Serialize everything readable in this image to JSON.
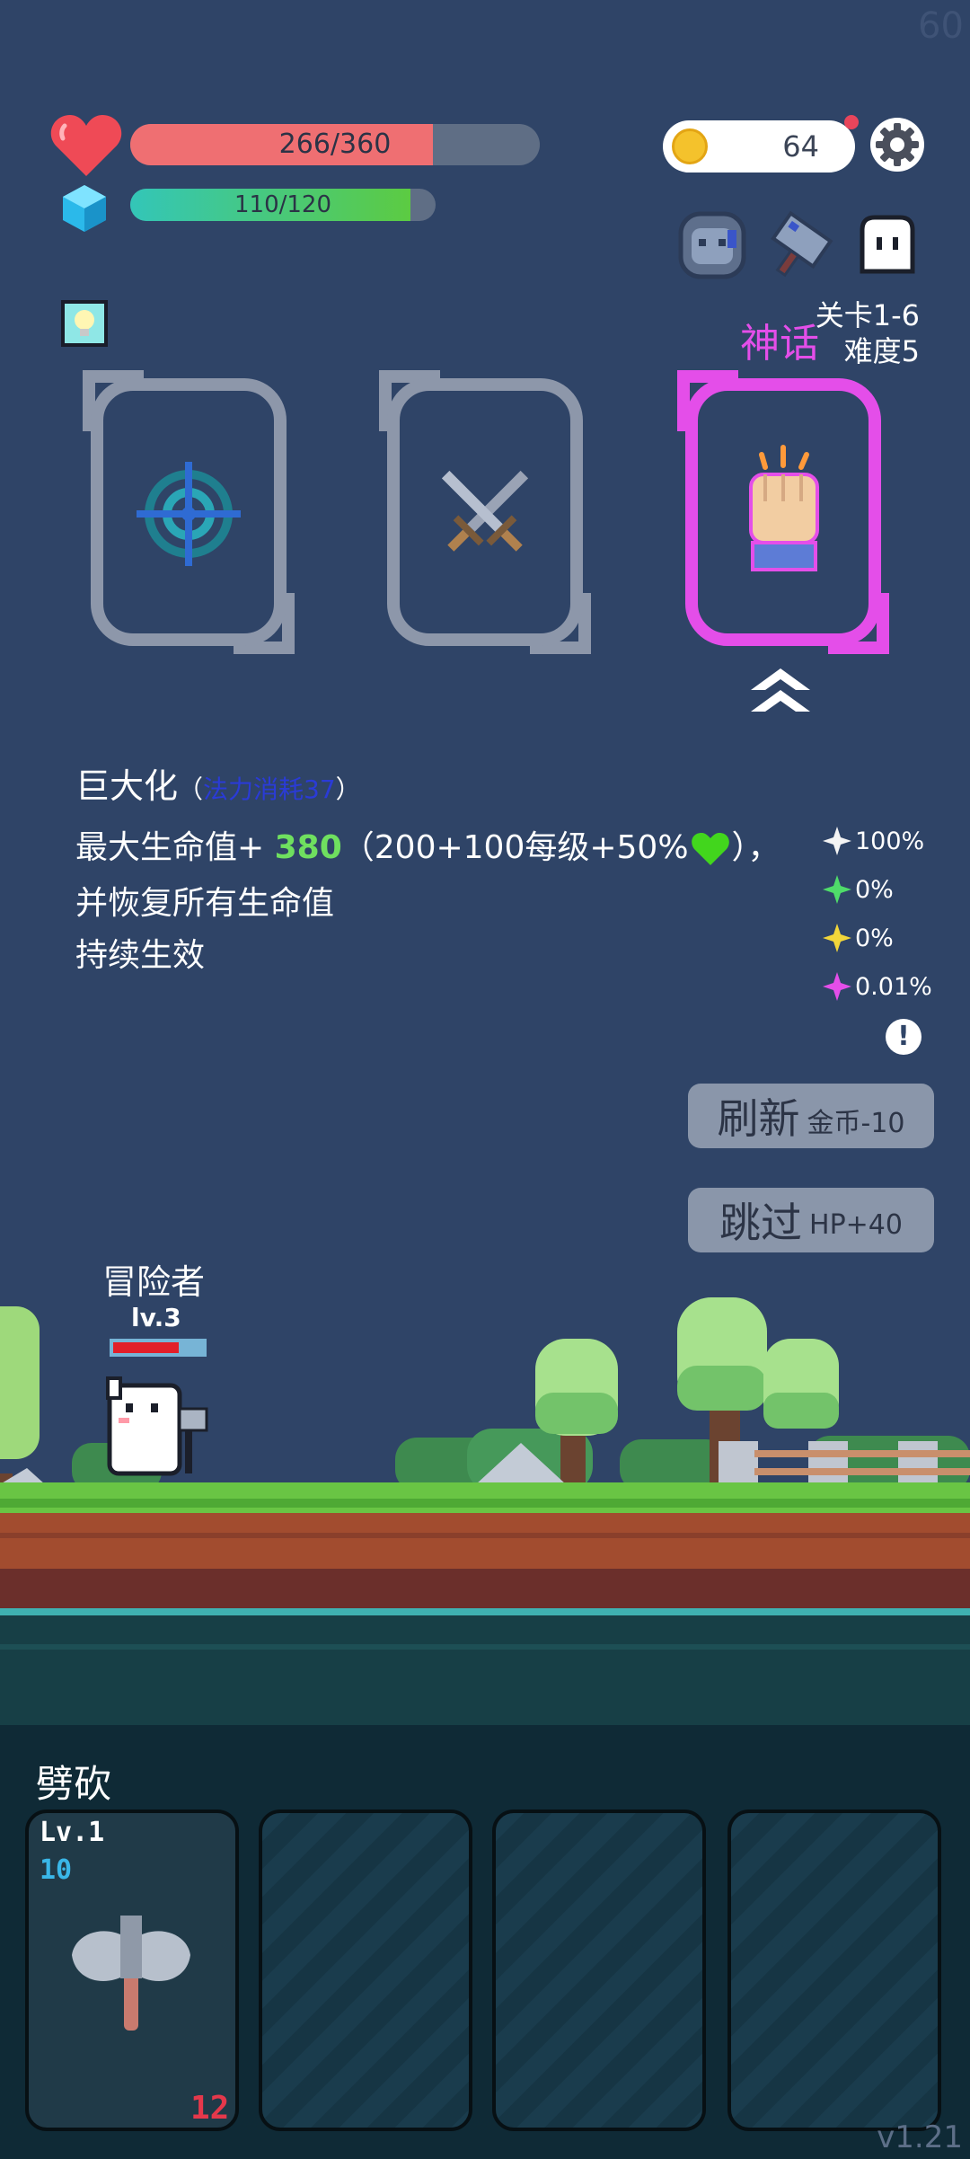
{
  "fps": "60",
  "version": "v1.21",
  "hud": {
    "hp": {
      "current": 266,
      "max": 360,
      "text": "266/360"
    },
    "mp": {
      "current": 110,
      "max": 120,
      "text": "110/120"
    },
    "coins": "64",
    "stage": "关卡1-6",
    "difficulty": "难度5",
    "rarity": "神话"
  },
  "icons": {
    "heart": "heart-icon",
    "gem": "mana-gem-icon",
    "coin": "coin-icon",
    "settings": "gear-icon",
    "hint": "lightbulb-icon",
    "cards": [
      "target-icon",
      "crossed-swords-icon",
      "fist-icon"
    ]
  },
  "skill_offer": {
    "name": "巨大化",
    "cost_open": "（",
    "cost": "法力消耗37",
    "cost_close": "）",
    "line1_prefix": "最大生命值+ ",
    "line1_value": "380",
    "line1_suffix": "（200+100每级+50%",
    "line1_end": "），",
    "line2": "并恢复所有生命值",
    "line3": "持续生效"
  },
  "odds": [
    {
      "color": "#f4f4f4",
      "value": "100%"
    },
    {
      "color": "#4fdc6a",
      "value": "0%"
    },
    {
      "color": "#f2d63a",
      "value": "0%"
    },
    {
      "color": "#e44ee9",
      "value": "0.01%"
    }
  ],
  "buttons": {
    "refresh_main": "刷新",
    "refresh_sub": "金币-10",
    "skip_main": "跳过",
    "skip_sub": "HP+40"
  },
  "player": {
    "name": "冒险者",
    "level": "lv.3",
    "hp_fraction": 0.75
  },
  "skills_panel": {
    "title": "劈砍",
    "slot1": {
      "level": "Lv.1",
      "power": "10",
      "cost": "12"
    }
  },
  "colors": {
    "background": "#2f4467",
    "hp": "#ef6f72",
    "mythic": "#e44ee9",
    "card_normal": "#8d97aa"
  }
}
